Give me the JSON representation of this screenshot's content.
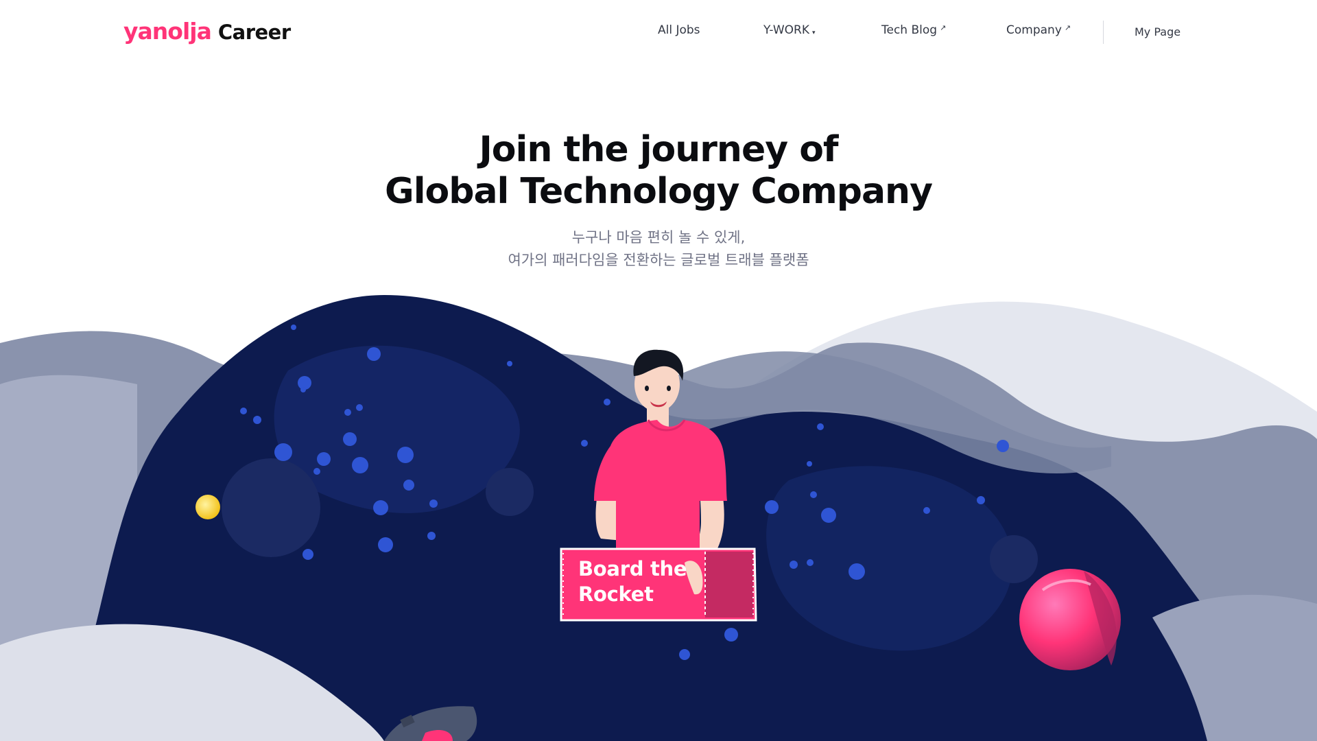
{
  "header": {
    "logo_brand": "yanolja",
    "logo_sub": "Career",
    "nav": [
      {
        "label": "All Jobs",
        "mark": ""
      },
      {
        "label": "Y-WORK",
        "mark": "▾"
      },
      {
        "label": "Tech Blog",
        "mark": "↗"
      },
      {
        "label": "Company",
        "mark": "↗"
      }
    ],
    "my_page": "My Page"
  },
  "hero": {
    "headline_line1": "Join the journey of",
    "headline_line2": "Global Technology Company",
    "subline_line1": "누구나 마음 편히 놀 수 있게,",
    "subline_line2": "여가의 패러다임을 전환하는 글로벌 트래블 플랫폼"
  },
  "ticket": {
    "line1": "Board the",
    "line2": "Rocket"
  },
  "colors": {
    "brand_pink": "#ff3478",
    "space_navy": "#0d1b4f",
    "wave_gray": "#8a93ad",
    "wave_light": "#e4e7ef",
    "star_blue": "#2f55d4"
  },
  "icons": [
    "external-link-icon",
    "dropdown-caret-icon"
  ]
}
